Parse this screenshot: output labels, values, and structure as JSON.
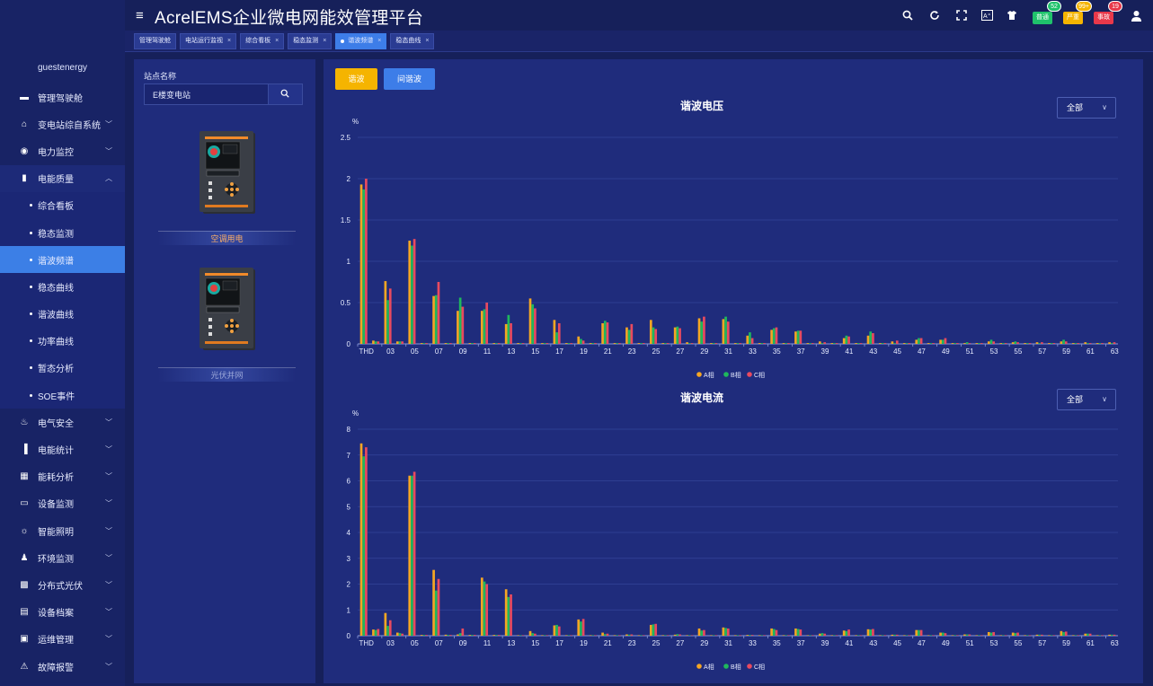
{
  "app": {
    "title": "AcrelEMS企业微电网能效管理平台",
    "user": "guestenergy"
  },
  "alerts": [
    {
      "label": "普通",
      "count": "52",
      "color": "g"
    },
    {
      "label": "严重",
      "count": "99+",
      "color": "y"
    },
    {
      "label": "事故",
      "count": "19",
      "color": "r"
    }
  ],
  "tabs": [
    {
      "label": "管理驾驶舱",
      "closable": false,
      "active": false
    },
    {
      "label": "电站运行监视",
      "closable": true,
      "active": false
    },
    {
      "label": "综合看板",
      "closable": true,
      "active": false
    },
    {
      "label": "稳态监测",
      "closable": true,
      "active": false
    },
    {
      "label": "谐波频谱",
      "closable": true,
      "active": true
    },
    {
      "label": "稳态曲线",
      "closable": true,
      "active": false
    }
  ],
  "menu": [
    {
      "label": "管理驾驶舱",
      "icon": "dashboard-icon",
      "glyph": "▬",
      "expandable": false
    },
    {
      "label": "变电站综自系统",
      "icon": "home-icon",
      "glyph": "⌂",
      "expandable": true
    },
    {
      "label": "电力监控",
      "icon": "power-icon",
      "glyph": "◉",
      "expandable": true
    },
    {
      "label": "电能质量",
      "icon": "quality-icon",
      "glyph": "▮",
      "expandable": true,
      "open": true,
      "children": [
        {
          "label": "综合看板",
          "active": false
        },
        {
          "label": "稳态监测",
          "active": false
        },
        {
          "label": "谐波频谱",
          "active": true
        },
        {
          "label": "稳态曲线",
          "active": false
        },
        {
          "label": "谐波曲线",
          "active": false
        },
        {
          "label": "功率曲线",
          "active": false
        },
        {
          "label": "暂态分析",
          "active": false
        },
        {
          "label": "SOE事件",
          "active": false
        }
      ]
    },
    {
      "label": "电气安全",
      "icon": "safety-icon",
      "glyph": "♨",
      "expandable": true
    },
    {
      "label": "电能统计",
      "icon": "stats-icon",
      "glyph": "▐",
      "expandable": true
    },
    {
      "label": "能耗分析",
      "icon": "analysis-icon",
      "glyph": "▦",
      "expandable": true
    },
    {
      "label": "设备监测",
      "icon": "monitor-icon",
      "glyph": "▭",
      "expandable": true
    },
    {
      "label": "智能照明",
      "icon": "light-icon",
      "glyph": "☼",
      "expandable": true
    },
    {
      "label": "环境监测",
      "icon": "env-icon",
      "glyph": "♟",
      "expandable": true
    },
    {
      "label": "分布式光伏",
      "icon": "pv-icon",
      "glyph": "▩",
      "expandable": true
    },
    {
      "label": "设备档案",
      "icon": "archive-icon",
      "glyph": "▤",
      "expandable": true
    },
    {
      "label": "运维管理",
      "icon": "ops-icon",
      "glyph": "▣",
      "expandable": true
    },
    {
      "label": "故障报警",
      "icon": "alarm-icon",
      "glyph": "⚠",
      "expandable": true
    }
  ],
  "station": {
    "label": "站点名称",
    "search_value": "E楼变电站",
    "devices": [
      {
        "name": "空调用电",
        "selected": true
      },
      {
        "name": "光伏并网",
        "selected": false
      }
    ]
  },
  "buttons": {
    "harmonic": "谐波",
    "interharmonic": "间谐波"
  },
  "colors": {
    "A": "#f5a623",
    "B": "#1fb85c",
    "C": "#e84a5f"
  },
  "chart_data": [
    {
      "type": "bar",
      "title": "谐波电压",
      "ylabel": "%",
      "ylim": [
        0,
        2.5
      ],
      "yticks": [
        "0",
        "0.5",
        "1",
        "1.5",
        "2",
        "2.5"
      ],
      "ytick_values": [
        0,
        0.5,
        1,
        1.5,
        2,
        2.5
      ],
      "filter": "全部",
      "categories": [
        "THD",
        "02",
        "03",
        "04",
        "05",
        "06",
        "07",
        "08",
        "09",
        "10",
        "11",
        "12",
        "13",
        "14",
        "15",
        "16",
        "17",
        "18",
        "19",
        "20",
        "21",
        "22",
        "23",
        "24",
        "25",
        "26",
        "27",
        "28",
        "29",
        "30",
        "31",
        "32",
        "33",
        "34",
        "35",
        "36",
        "37",
        "38",
        "39",
        "40",
        "41",
        "42",
        "43",
        "44",
        "45",
        "46",
        "47",
        "48",
        "49",
        "50",
        "51",
        "52",
        "53",
        "54",
        "55",
        "56",
        "57",
        "58",
        "59",
        "60",
        "61",
        "62",
        "63"
      ],
      "xticklabels": [
        "THD",
        "03",
        "05",
        "07",
        "09",
        "11",
        "13",
        "15",
        "17",
        "19",
        "21",
        "23",
        "25",
        "27",
        "29",
        "31",
        "33",
        "35",
        "37",
        "39",
        "41",
        "43",
        "45",
        "47",
        "49",
        "51",
        "53",
        "55",
        "57",
        "59",
        "61",
        "63"
      ],
      "series": [
        {
          "name": "A相",
          "values": [
            1.93,
            0.04,
            0.76,
            0.03,
            1.25,
            0.01,
            0.58,
            0.01,
            0.4,
            0.01,
            0.4,
            0.01,
            0.24,
            0.01,
            0.55,
            0.01,
            0.29,
            0.01,
            0.09,
            0.01,
            0.25,
            0.01,
            0.2,
            0.01,
            0.29,
            0.01,
            0.2,
            0.02,
            0.31,
            0.01,
            0.3,
            0.01,
            0.1,
            0.01,
            0.17,
            0.01,
            0.15,
            0.01,
            0.03,
            0.01,
            0.07,
            0.01,
            0.1,
            0.01,
            0.03,
            0.01,
            0.05,
            0.01,
            0.05,
            0.01,
            0.01,
            0.01,
            0.03,
            0.01,
            0.02,
            0.01,
            0.02,
            0.01,
            0.03,
            0.01,
            0.02,
            0.01,
            0.02
          ]
        },
        {
          "name": "B相",
          "values": [
            1.87,
            0.03,
            0.53,
            0.03,
            1.19,
            0.01,
            0.59,
            0.01,
            0.56,
            0.01,
            0.42,
            0.01,
            0.35,
            0.01,
            0.48,
            0.01,
            0.14,
            0.01,
            0.06,
            0.01,
            0.28,
            0.01,
            0.17,
            0.01,
            0.2,
            0.01,
            0.21,
            0.01,
            0.27,
            0.01,
            0.33,
            0.01,
            0.14,
            0.01,
            0.19,
            0.01,
            0.16,
            0.01,
            0.01,
            0.01,
            0.1,
            0.01,
            0.15,
            0.01,
            0.01,
            0.01,
            0.07,
            0.01,
            0.05,
            0.01,
            0.02,
            0.01,
            0.05,
            0.01,
            0.03,
            0.01,
            0.01,
            0.01,
            0.05,
            0.01,
            0.01,
            0.01,
            0.01
          ]
        },
        {
          "name": "C相",
          "values": [
            2.0,
            0.03,
            0.67,
            0.03,
            1.27,
            0.01,
            0.75,
            0.01,
            0.45,
            0.01,
            0.5,
            0.01,
            0.25,
            0.01,
            0.43,
            0.01,
            0.25,
            0.01,
            0.04,
            0.01,
            0.26,
            0.01,
            0.24,
            0.01,
            0.18,
            0.01,
            0.19,
            0.01,
            0.33,
            0.01,
            0.27,
            0.01,
            0.07,
            0.01,
            0.2,
            0.01,
            0.16,
            0.01,
            0.02,
            0.01,
            0.09,
            0.01,
            0.13,
            0.01,
            0.04,
            0.01,
            0.07,
            0.01,
            0.07,
            0.01,
            0.01,
            0.01,
            0.03,
            0.01,
            0.02,
            0.01,
            0.02,
            0.01,
            0.03,
            0.01,
            0.01,
            0.01,
            0.02
          ]
        }
      ],
      "legend": [
        "A相",
        "B相",
        "C相"
      ]
    },
    {
      "type": "bar",
      "title": "谐波电流",
      "ylabel": "%",
      "ylim": [
        0,
        8
      ],
      "yticks": [
        "0",
        "1",
        "2",
        "3",
        "4",
        "5",
        "6",
        "7",
        "8"
      ],
      "ytick_values": [
        0,
        1,
        2,
        3,
        4,
        5,
        6,
        7,
        8
      ],
      "filter": "全部",
      "categories": [
        "THD",
        "02",
        "03",
        "04",
        "05",
        "06",
        "07",
        "08",
        "09",
        "10",
        "11",
        "12",
        "13",
        "14",
        "15",
        "16",
        "17",
        "18",
        "19",
        "20",
        "21",
        "22",
        "23",
        "24",
        "25",
        "26",
        "27",
        "28",
        "29",
        "30",
        "31",
        "32",
        "33",
        "34",
        "35",
        "36",
        "37",
        "38",
        "39",
        "40",
        "41",
        "42",
        "43",
        "44",
        "45",
        "46",
        "47",
        "48",
        "49",
        "50",
        "51",
        "52",
        "53",
        "54",
        "55",
        "56",
        "57",
        "58",
        "59",
        "60",
        "61",
        "62",
        "63"
      ],
      "xticklabels": [
        "THD",
        "03",
        "05",
        "07",
        "09",
        "11",
        "13",
        "15",
        "17",
        "19",
        "21",
        "23",
        "25",
        "27",
        "29",
        "31",
        "33",
        "35",
        "37",
        "39",
        "41",
        "43",
        "45",
        "47",
        "49",
        "51",
        "53",
        "55",
        "57",
        "59",
        "61",
        "63"
      ],
      "series": [
        {
          "name": "A相",
          "values": [
            7.45,
            0.24,
            0.88,
            0.12,
            6.2,
            0.03,
            2.55,
            0.04,
            0.05,
            0.03,
            2.25,
            0.03,
            1.8,
            0.02,
            0.18,
            0.02,
            0.4,
            0.02,
            0.63,
            0.02,
            0.12,
            0.02,
            0.05,
            0.02,
            0.42,
            0.02,
            0.04,
            0.02,
            0.28,
            0.02,
            0.32,
            0.02,
            0.03,
            0.02,
            0.28,
            0.02,
            0.28,
            0.02,
            0.08,
            0.02,
            0.2,
            0.02,
            0.25,
            0.02,
            0.04,
            0.02,
            0.22,
            0.02,
            0.12,
            0.02,
            0.05,
            0.02,
            0.14,
            0.02,
            0.12,
            0.02,
            0.04,
            0.02,
            0.18,
            0.02,
            0.08,
            0.02,
            0.04
          ]
        },
        {
          "name": "B相",
          "values": [
            6.95,
            0.22,
            0.38,
            0.1,
            6.2,
            0.03,
            1.75,
            0.03,
            0.1,
            0.03,
            2.1,
            0.03,
            1.5,
            0.02,
            0.1,
            0.02,
            0.42,
            0.02,
            0.55,
            0.02,
            0.06,
            0.02,
            0.04,
            0.02,
            0.44,
            0.02,
            0.06,
            0.02,
            0.2,
            0.02,
            0.3,
            0.02,
            0.03,
            0.02,
            0.26,
            0.02,
            0.26,
            0.02,
            0.1,
            0.02,
            0.18,
            0.02,
            0.24,
            0.02,
            0.04,
            0.02,
            0.22,
            0.02,
            0.12,
            0.02,
            0.05,
            0.02,
            0.12,
            0.02,
            0.1,
            0.02,
            0.04,
            0.02,
            0.14,
            0.02,
            0.08,
            0.02,
            0.04
          ]
        },
        {
          "name": "C相",
          "values": [
            7.3,
            0.26,
            0.6,
            0.08,
            6.35,
            0.03,
            2.2,
            0.03,
            0.28,
            0.03,
            2.0,
            0.03,
            1.6,
            0.02,
            0.08,
            0.02,
            0.36,
            0.02,
            0.65,
            0.02,
            0.08,
            0.02,
            0.05,
            0.02,
            0.46,
            0.02,
            0.05,
            0.02,
            0.22,
            0.02,
            0.28,
            0.02,
            0.03,
            0.02,
            0.22,
            0.02,
            0.24,
            0.02,
            0.08,
            0.02,
            0.24,
            0.02,
            0.26,
            0.02,
            0.04,
            0.02,
            0.22,
            0.02,
            0.1,
            0.02,
            0.05,
            0.02,
            0.14,
            0.02,
            0.12,
            0.02,
            0.04,
            0.02,
            0.16,
            0.02,
            0.08,
            0.02,
            0.04
          ]
        }
      ],
      "legend": [
        "A相",
        "B相",
        "C相"
      ]
    }
  ]
}
